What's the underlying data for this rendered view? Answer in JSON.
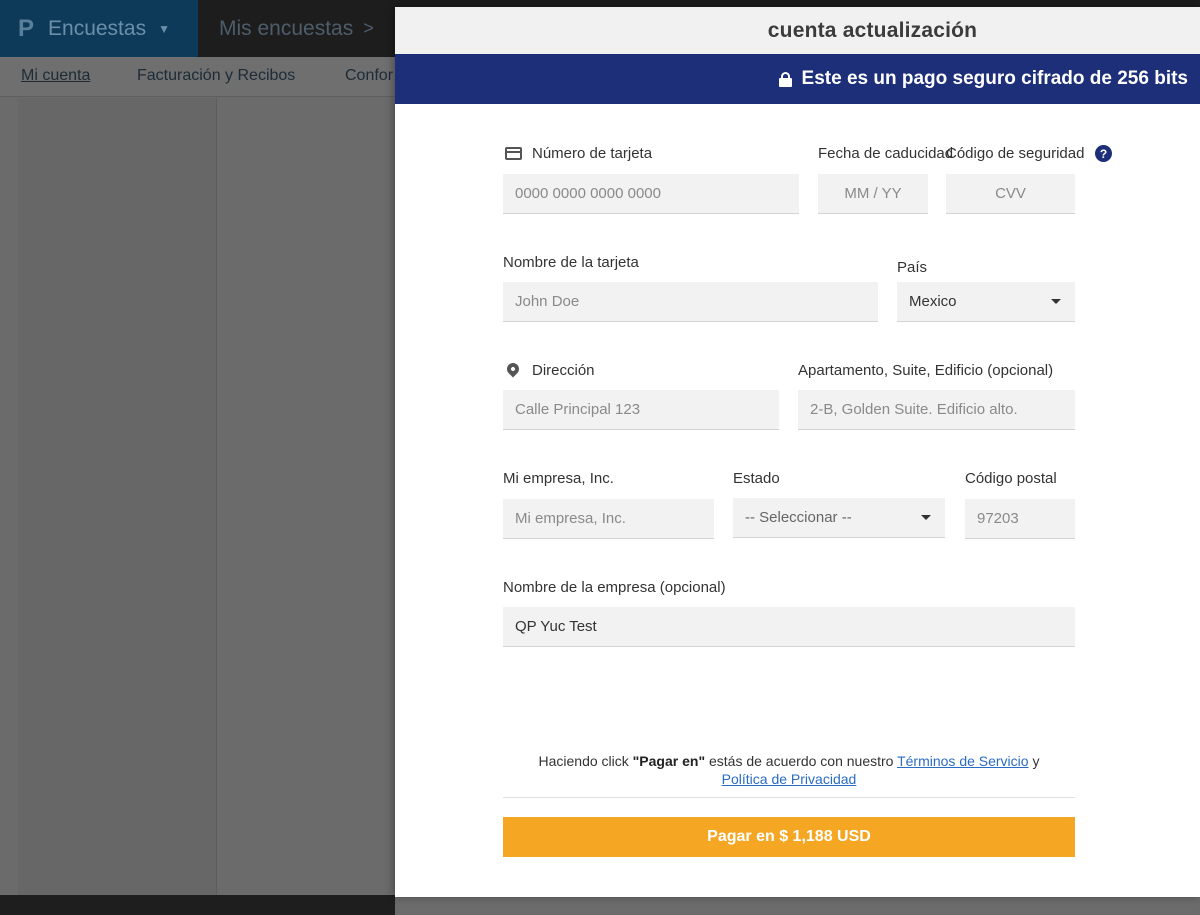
{
  "app": {
    "brand": "Encuestas",
    "breadcrumb": "Mis encuestas",
    "subnav": [
      "Mi cuenta",
      "Facturación y Recibos",
      "Confor"
    ]
  },
  "modal": {
    "title": "cuenta actualización",
    "secure_text": "Este es un pago seguro cifrado de 256 bits",
    "card_number": {
      "label": "Número de tarjeta",
      "placeholder": "0000 0000 0000 0000"
    },
    "expiry": {
      "label": "Fecha de caducidad",
      "placeholder": "MM / YY"
    },
    "security_code": {
      "label": "Código de seguridad",
      "placeholder": "CVV",
      "help": "?"
    },
    "card_name": {
      "label": "Nombre de la tarjeta",
      "placeholder": "John Doe"
    },
    "country": {
      "label": "País",
      "value": "Mexico"
    },
    "address": {
      "label": "Dirección",
      "placeholder": "Calle Principal 123"
    },
    "apartment": {
      "label": "Apartamento, Suite, Edificio (opcional)",
      "placeholder": "2-B, Golden Suite. Edificio alto."
    },
    "city": {
      "label": "Mi empresa, Inc.",
      "placeholder": "Mi empresa, Inc."
    },
    "state": {
      "label": "Estado",
      "value": "-- Seleccionar --"
    },
    "postal_code": {
      "label": "Código postal",
      "placeholder": "97203"
    },
    "company": {
      "label": "Nombre de la empresa (opcional)",
      "value": "QP Yuc Test"
    },
    "terms": {
      "prefix": "Haciendo click ",
      "bold": "\"Pagar en\"",
      "middle": " estás de acuerdo con nuestro ",
      "tos_link": "Términos de Servicio",
      "and": " y",
      "privacy_link": "Política de Privacidad"
    },
    "pay_button": "Pagar en $ 1,188 USD"
  }
}
